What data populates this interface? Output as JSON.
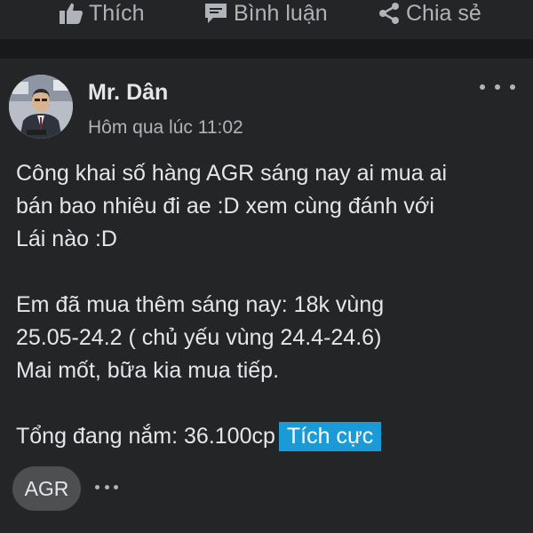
{
  "actions": {
    "like_label": "Thích",
    "comment_label": "Bình luận",
    "share_label": "Chia sẻ"
  },
  "post": {
    "author": "Mr. Dân",
    "timestamp": "Hôm qua lúc 11:02",
    "lines": [
      "Công khai số hàng AGR sáng nay ai mua ai",
      "bán bao nhiêu đi ae :D xem cùng đánh với",
      "Lái nào :D",
      "Em đã mua thêm sáng nay: 18k vùng",
      "25.05-24.2 ( chủ yếu vùng 24.4-24.6)",
      "Mai mốt, bữa kia mua tiếp.",
      "Tổng đang nắm: 36.100cp"
    ],
    "badge": "Tích cực",
    "tag": "AGR"
  },
  "colors": {
    "background": "#18191a",
    "card": "#242526",
    "text": "#e4e6eb",
    "muted": "#b0b3b8",
    "badge": "#1a9bd7",
    "pill": "#4e4f50"
  },
  "icons": [
    "thumbs-up-icon",
    "comment-icon",
    "share-icon",
    "more-icon"
  ]
}
